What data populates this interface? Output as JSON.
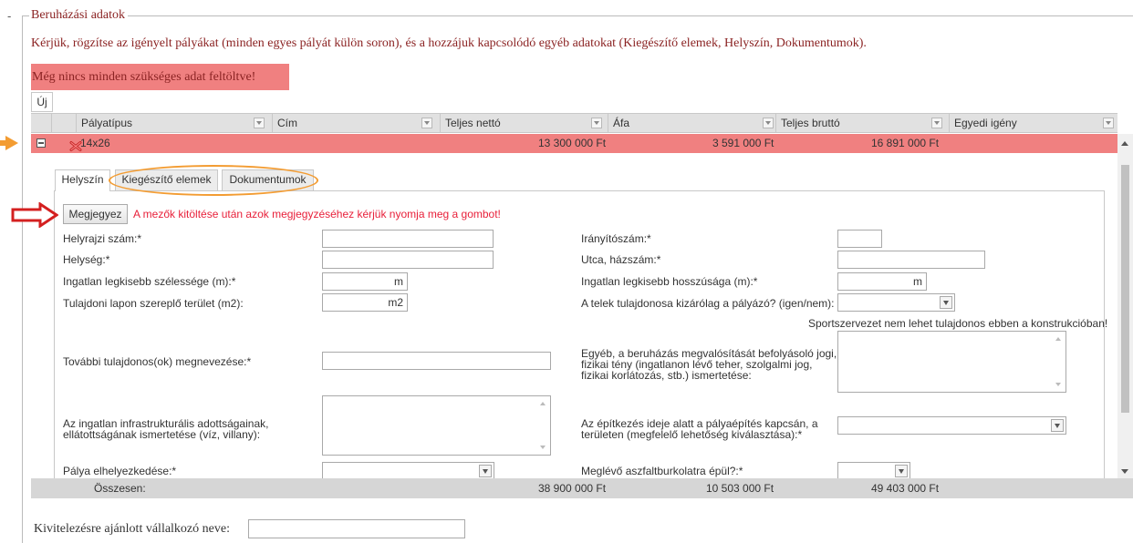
{
  "section": {
    "dash": "-",
    "legend": "Beruházási adatok",
    "intro": "Kérjük, rögzítse az igényelt pályákat (minden egyes pályát külön soron), és a hozzájuk kapcsolódó egyéb adatokat (Kiegészítő elemek, Helyszín, Dokumentumok).",
    "alert": "Még nincs minden szükséges adat feltöltve!"
  },
  "toolbar": {
    "new_label": "Új"
  },
  "grid": {
    "columns": [
      "Pályatípus",
      "Cím",
      "Teljes nettó",
      "Áfa",
      "Teljes bruttó",
      "Egyedi igény"
    ],
    "row": {
      "type": "14x26",
      "address": "",
      "net": "13 300 000 Ft",
      "vat": "3 591 000 Ft",
      "gross": "16 891 000 Ft",
      "custom": ""
    },
    "totals": {
      "label": "Összesen:",
      "net": "38 900 000 Ft",
      "vat": "10 503 000 Ft",
      "gross": "49 403 000 Ft"
    }
  },
  "tabs": [
    "Helyszín",
    "Kiegészítő elemek",
    "Dokumentumok"
  ],
  "form": {
    "save_label": "Megjegyez",
    "save_hint": "A mezők kitöltése után azok megjegyzéséhez kérjük nyomja meg a gombot!",
    "labels": {
      "hrsz": "Helyrajzi szám:*",
      "iranyito": "Irányítószám:*",
      "helyseg": "Helység:*",
      "utca": "Utca, házszám:*",
      "szelesseg": "Ingatlan legkisebb szélessége (m):*",
      "hosszusag": "Ingatlan legkisebb hosszúsága (m):*",
      "terulet": "Tulajdoni lapon szereplő terület (m2):",
      "tulajdonos": "A telek tulajdonosa kizárólag a pályázó? (igen/nem):",
      "sport_note": "Sportszervezet nem lehet tulajdonos ebben a konstrukcióban!",
      "tovabbi": "További tulajdonos(ok) megnevezése:*",
      "egyeb_1": "Egyéb, a beruházás megvalósítását befolyásoló jogi,",
      "egyeb_2": "fizikai tény (ingatlanon lévő teher, szolgalmi jog,",
      "egyeb_3": "fizikai korlátozás, stb.) ismertetése:",
      "infra_1": "Az ingatlan infrastrukturális adottságainak,",
      "infra_2": "ellátottságának ismertetése (víz, villany):",
      "epites_1": "Az építkezés ideje alatt a pályaépítés kapcsán, a",
      "epites_2": "területen (megfelelő lehetőség kiválasztása):*",
      "elhelyezkedes": "Pálya elhelyezkedése:*",
      "aszfalt": "Meglévő aszfaltburkolatra épül?:*"
    },
    "units": {
      "m": "m",
      "m2": "m2"
    }
  },
  "footer": {
    "contractor_label": "Kivitelezésre ajánlott vállalkozó neve:"
  },
  "colors": {
    "alert_bg": "#f08080",
    "alert_text": "#8b2323",
    "hint_red": "#e8203a",
    "annotation_orange": "#f39c32",
    "annotation_red": "#d42020"
  }
}
